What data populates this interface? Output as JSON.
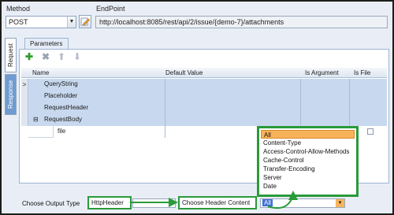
{
  "top": {
    "method_label": "Method",
    "endpoint_label": "EndPoint",
    "method_value": "POST",
    "endpoint_value": "http://localhost:8085/rest/api/2/issue/{demo-7}/attachments"
  },
  "side_tabs": {
    "request": "Request",
    "response": "Response"
  },
  "params": {
    "tab_label": "Parameters",
    "columns": [
      "Name",
      "Default Value",
      "Is Argument",
      "Is File"
    ],
    "rows": [
      "QueryString",
      "Placeholder",
      "RequestHeader",
      "RequestBody"
    ],
    "child_row": "file",
    "row_markers": {
      "first": ">",
      "expanded": "⊟"
    }
  },
  "dropdown": {
    "items": [
      "All",
      "Content-Type",
      "Access-Control-Allow-Methods",
      "Cache-Control",
      "Transfer-Encoding",
      "Server",
      "Date"
    ],
    "selected": "All"
  },
  "bottom": {
    "output_label": "Choose Output Type",
    "output_value": "HttpHeader",
    "header_label": "Choose Header Content",
    "header_value": "All"
  },
  "icons": {
    "add": "plus-icon",
    "remove": "x-icon",
    "up": "arrow-up-icon",
    "down": "arrow-down-icon",
    "edit": "edit-icon"
  },
  "colors": {
    "accent_green": "#2a9a3a",
    "selection_orange": "#f8b25a",
    "row_blue": "#c8d9ef"
  }
}
